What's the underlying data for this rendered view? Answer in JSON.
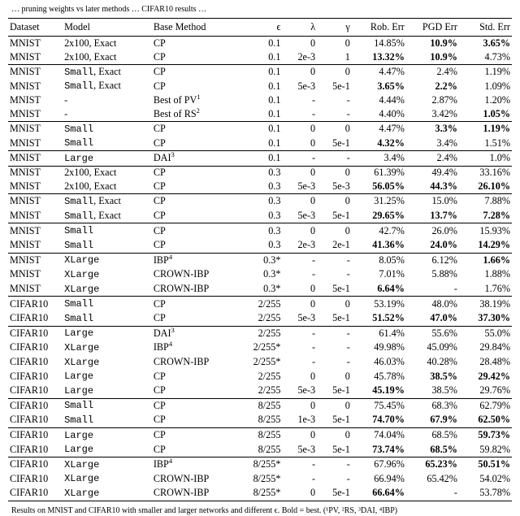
{
  "topcaption": "… pruning weights vs later methods … CIFAR10 results …",
  "headers": {
    "dataset": "Dataset",
    "model": "Model",
    "method": "Base Method",
    "eps": "ϵ",
    "lambda": "λ",
    "gamma": "γ",
    "rob": "Rob. Err",
    "pgd": "PGD Err",
    "std": "Std. Err"
  },
  "footnote": "Results on MNIST and CIFAR10 with smaller and larger networks and different ϵ. Bold = best. (¹PV, ²RS, ³DAI, ⁴IBP)",
  "groups": [
    [
      {
        "dataset": "MNIST",
        "model": "2x100, Exact",
        "method": "CP",
        "eps": "0.1",
        "lambda": "0",
        "gamma": "0",
        "rob": [
          "14.85%",
          0
        ],
        "pgd": [
          "10.9%",
          1
        ],
        "std": [
          "3.65%",
          1
        ]
      },
      {
        "dataset": "MNIST",
        "model": "2x100, Exact",
        "method": "CP",
        "eps": "0.1",
        "lambda": "2e-3",
        "gamma": "1",
        "rob": [
          "13.32%",
          1
        ],
        "pgd": [
          "10.9%",
          1
        ],
        "std": [
          "4.73%",
          0
        ]
      }
    ],
    [
      {
        "dataset": "MNIST",
        "model": "Small, Exact",
        "modelMono": 1,
        "method": "CP",
        "eps": "0.1",
        "lambda": "0",
        "gamma": "0",
        "rob": [
          "4.47%",
          0
        ],
        "pgd": [
          "2.4%",
          0
        ],
        "std": [
          "1.19%",
          0
        ]
      },
      {
        "dataset": "MNIST",
        "model": "Small, Exact",
        "modelMono": 1,
        "method": "CP",
        "eps": "0.1",
        "lambda": "5e-3",
        "gamma": "5e-1",
        "rob": [
          "3.65%",
          1
        ],
        "pgd": [
          "2.2%",
          1
        ],
        "std": [
          "1.09%",
          0
        ]
      },
      {
        "dataset": "MNIST",
        "model": "-",
        "method": "Best of PV",
        "sup": "1",
        "eps": "0.1",
        "lambda": "-",
        "gamma": "-",
        "rob": [
          "4.44%",
          0
        ],
        "pgd": [
          "2.87%",
          0
        ],
        "std": [
          "1.20%",
          0
        ]
      },
      {
        "dataset": "MNIST",
        "model": "-",
        "method": "Best of RS",
        "sup": "2",
        "eps": "0.1",
        "lambda": "-",
        "gamma": "-",
        "rob": [
          "4.40%",
          0
        ],
        "pgd": [
          "3.42%",
          0
        ],
        "std": [
          "1.05%",
          1
        ]
      }
    ],
    [
      {
        "dataset": "MNIST",
        "model": "Small",
        "modelMono": 1,
        "method": "CP",
        "eps": "0.1",
        "lambda": "0",
        "gamma": "0",
        "rob": [
          "4.47%",
          0
        ],
        "pgd": [
          "3.3%",
          1
        ],
        "std": [
          "1.19%",
          1
        ]
      },
      {
        "dataset": "MNIST",
        "model": "Small",
        "modelMono": 1,
        "method": "CP",
        "eps": "0.1",
        "lambda": "0",
        "gamma": "5e-1",
        "rob": [
          "4.32%",
          1
        ],
        "pgd": [
          "3.4%",
          0
        ],
        "std": [
          "1.51%",
          0
        ]
      }
    ],
    [
      {
        "dataset": "MNIST",
        "model": "Large",
        "modelMono": 1,
        "method": "DAI",
        "sup": "3",
        "eps": "0.1",
        "lambda": "-",
        "gamma": "-",
        "rob": [
          "3.4%",
          0
        ],
        "pgd": [
          "2.4%",
          0
        ],
        "std": [
          "1.0%",
          0
        ]
      }
    ],
    [
      {
        "dataset": "MNIST",
        "model": "2x100, Exact",
        "method": "CP",
        "eps": "0.3",
        "lambda": "0",
        "gamma": "0",
        "rob": [
          "61.39%",
          0
        ],
        "pgd": [
          "49.4%",
          0
        ],
        "std": [
          "33.16%",
          0
        ]
      },
      {
        "dataset": "MNIST",
        "model": "2x100, Exact",
        "method": "CP",
        "eps": "0.3",
        "lambda": "5e-3",
        "gamma": "5e-3",
        "rob": [
          "56.05%",
          1
        ],
        "pgd": [
          "44.3%",
          1
        ],
        "std": [
          "26.10%",
          1
        ]
      }
    ],
    [
      {
        "dataset": "MNIST",
        "model": "Small, Exact",
        "modelMono": 1,
        "method": "CP",
        "eps": "0.3",
        "lambda": "0",
        "gamma": "0",
        "rob": [
          "31.25%",
          0
        ],
        "pgd": [
          "15.0%",
          0
        ],
        "std": [
          "7.88%",
          0
        ]
      },
      {
        "dataset": "MNIST",
        "model": "Small, Exact",
        "modelMono": 1,
        "method": "CP",
        "eps": "0.3",
        "lambda": "5e-3",
        "gamma": "5e-1",
        "rob": [
          "29.65%",
          1
        ],
        "pgd": [
          "13.7%",
          1
        ],
        "std": [
          "7.28%",
          1
        ]
      }
    ],
    [
      {
        "dataset": "MNIST",
        "model": "Small",
        "modelMono": 1,
        "method": "CP",
        "eps": "0.3",
        "lambda": "0",
        "gamma": "0",
        "rob": [
          "42.7%",
          0
        ],
        "pgd": [
          "26.0%",
          0
        ],
        "std": [
          "15.93%",
          0
        ]
      },
      {
        "dataset": "MNIST",
        "model": "Small",
        "modelMono": 1,
        "method": "CP",
        "eps": "0.3",
        "lambda": "2e-3",
        "gamma": "2e-1",
        "rob": [
          "41.36%",
          1
        ],
        "pgd": [
          "24.0%",
          1
        ],
        "std": [
          "14.29%",
          1
        ]
      }
    ],
    [
      {
        "dataset": "MNIST",
        "model": "XLarge",
        "modelMono": 1,
        "method": "IBP",
        "sup": "4",
        "eps": "0.3*",
        "lambda": "-",
        "gamma": "-",
        "rob": [
          "8.05%",
          0
        ],
        "pgd": [
          "6.12%",
          0
        ],
        "std": [
          "1.66%",
          1
        ]
      },
      {
        "dataset": "MNIST",
        "model": "XLarge",
        "modelMono": 1,
        "method": "CROWN-IBP",
        "eps": "0.3*",
        "lambda": "-",
        "gamma": "-",
        "rob": [
          "7.01%",
          0
        ],
        "pgd": [
          "5.88%",
          0
        ],
        "std": [
          "1.88%",
          0
        ]
      },
      {
        "dataset": "MNIST",
        "model": "XLarge",
        "modelMono": 1,
        "method": "CROWN-IBP",
        "eps": "0.3*",
        "lambda": "0",
        "gamma": "5e-1",
        "rob": [
          "6.64%",
          1
        ],
        "pgd": [
          "-",
          0
        ],
        "std": [
          "1.76%",
          0
        ]
      }
    ],
    [
      {
        "dataset": "CIFAR10",
        "model": "Small",
        "modelMono": 1,
        "method": "CP",
        "eps": "2/255",
        "lambda": "0",
        "gamma": "0",
        "rob": [
          "53.19%",
          0
        ],
        "pgd": [
          "48.0%",
          0
        ],
        "std": [
          "38.19%",
          0
        ]
      },
      {
        "dataset": "CIFAR10",
        "model": "Small",
        "modelMono": 1,
        "method": "CP",
        "eps": "2/255",
        "lambda": "5e-3",
        "gamma": "5e-1",
        "rob": [
          "51.52%",
          1
        ],
        "pgd": [
          "47.0%",
          1
        ],
        "std": [
          "37.30%",
          1
        ]
      }
    ],
    [
      {
        "dataset": "CIFAR10",
        "model": "Large",
        "modelMono": 1,
        "method": "DAI",
        "sup": "3",
        "eps": "2/255",
        "lambda": "-",
        "gamma": "-",
        "rob": [
          "61.4%",
          0
        ],
        "pgd": [
          "55.6%",
          0
        ],
        "std": [
          "55.0%",
          0
        ]
      },
      {
        "dataset": "CIFAR10",
        "model": "XLarge",
        "modelMono": 1,
        "method": "IBP",
        "sup": "4",
        "eps": "2/255*",
        "lambda": "-",
        "gamma": "-",
        "rob": [
          "49.98%",
          0
        ],
        "pgd": [
          "45.09%",
          0
        ],
        "std": [
          "29.84%",
          0
        ]
      },
      {
        "dataset": "CIFAR10",
        "model": "XLarge",
        "modelMono": 1,
        "method": "CROWN-IBP",
        "eps": "2/255*",
        "lambda": "-",
        "gamma": "-",
        "rob": [
          "46.03%",
          0
        ],
        "pgd": [
          "40.28%",
          0
        ],
        "std": [
          "28.48%",
          0
        ]
      },
      {
        "dataset": "CIFAR10",
        "model": "Large",
        "modelMono": 1,
        "method": "CP",
        "eps": "2/255",
        "lambda": "0",
        "gamma": "0",
        "rob": [
          "45.78%",
          0
        ],
        "pgd": [
          "38.5%",
          1
        ],
        "std": [
          "29.42%",
          1
        ]
      },
      {
        "dataset": "CIFAR10",
        "model": "Large",
        "modelMono": 1,
        "method": "CP",
        "eps": "2/255",
        "lambda": "5e-3",
        "gamma": "5e-1",
        "rob": [
          "45.19%",
          1
        ],
        "pgd": [
          "38.5%",
          0
        ],
        "std": [
          "29.76%",
          0
        ]
      }
    ],
    [
      {
        "dataset": "CIFAR10",
        "model": "Small",
        "modelMono": 1,
        "method": "CP",
        "eps": "8/255",
        "lambda": "0",
        "gamma": "0",
        "rob": [
          "75.45%",
          0
        ],
        "pgd": [
          "68.3%",
          0
        ],
        "std": [
          "62.79%",
          0
        ]
      },
      {
        "dataset": "CIFAR10",
        "model": "Small",
        "modelMono": 1,
        "method": "CP",
        "eps": "8/255",
        "lambda": "1e-3",
        "gamma": "5e-1",
        "rob": [
          "74.70%",
          1
        ],
        "pgd": [
          "67.9%",
          1
        ],
        "std": [
          "62.50%",
          1
        ]
      }
    ],
    [
      {
        "dataset": "CIFAR10",
        "model": "Large",
        "modelMono": 1,
        "method": "CP",
        "eps": "8/255",
        "lambda": "0",
        "gamma": "0",
        "rob": [
          "74.04%",
          0
        ],
        "pgd": [
          "68.5%",
          0
        ],
        "std": [
          "59.73%",
          1
        ]
      },
      {
        "dataset": "CIFAR10",
        "model": "Large",
        "modelMono": 1,
        "method": "CP",
        "eps": "8/255",
        "lambda": "5e-3",
        "gamma": "5e-1",
        "rob": [
          "73.74%",
          1
        ],
        "pgd": [
          "68.5%",
          1
        ],
        "std": [
          "59.82%",
          0
        ]
      }
    ],
    [
      {
        "dataset": "CIFAR10",
        "model": "XLarge",
        "modelMono": 1,
        "method": "IBP",
        "sup": "4",
        "eps": "8/255*",
        "lambda": "-",
        "gamma": "-",
        "rob": [
          "67.96%",
          0
        ],
        "pgd": [
          "65.23%",
          1
        ],
        "std": [
          "50.51%",
          1
        ]
      },
      {
        "dataset": "CIFAR10",
        "model": "XLarge",
        "modelMono": 1,
        "method": "CROWN-IBP",
        "eps": "8/255*",
        "lambda": "-",
        "gamma": "-",
        "rob": [
          "66.94%",
          0
        ],
        "pgd": [
          "65.42%",
          0
        ],
        "std": [
          "54.02%",
          0
        ]
      },
      {
        "dataset": "CIFAR10",
        "model": "XLarge",
        "modelMono": 1,
        "method": "CROWN-IBP",
        "eps": "8/255*",
        "lambda": "0",
        "gamma": "5e-1",
        "rob": [
          "66.64%",
          1
        ],
        "pgd": [
          "-",
          0
        ],
        "std": [
          "53.78%",
          0
        ]
      }
    ]
  ]
}
